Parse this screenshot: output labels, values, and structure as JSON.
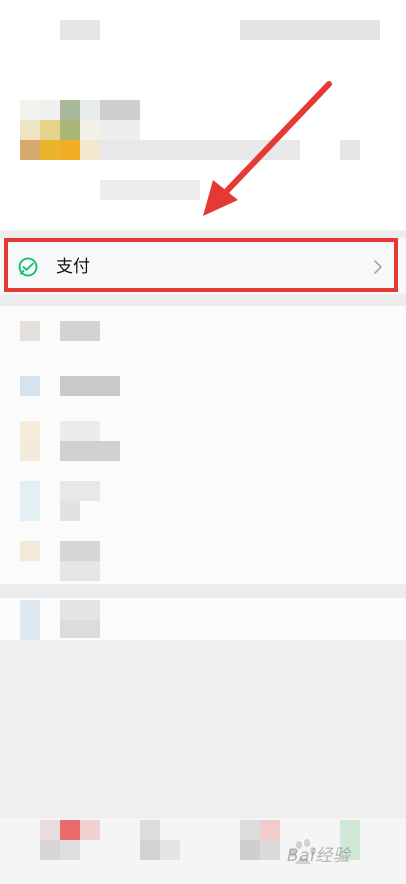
{
  "menu": {
    "pay_label": "支付",
    "pay_icon": "wechat-pay-icon",
    "chevron_icon": "chevron-right-icon"
  },
  "annotation": {
    "highlight_color": "#e53935",
    "arrow_color": "#e53935"
  },
  "watermark": {
    "text": "Bai经验"
  },
  "colors": {
    "accent_green": "#07c160",
    "page_bg": "#ededed"
  }
}
